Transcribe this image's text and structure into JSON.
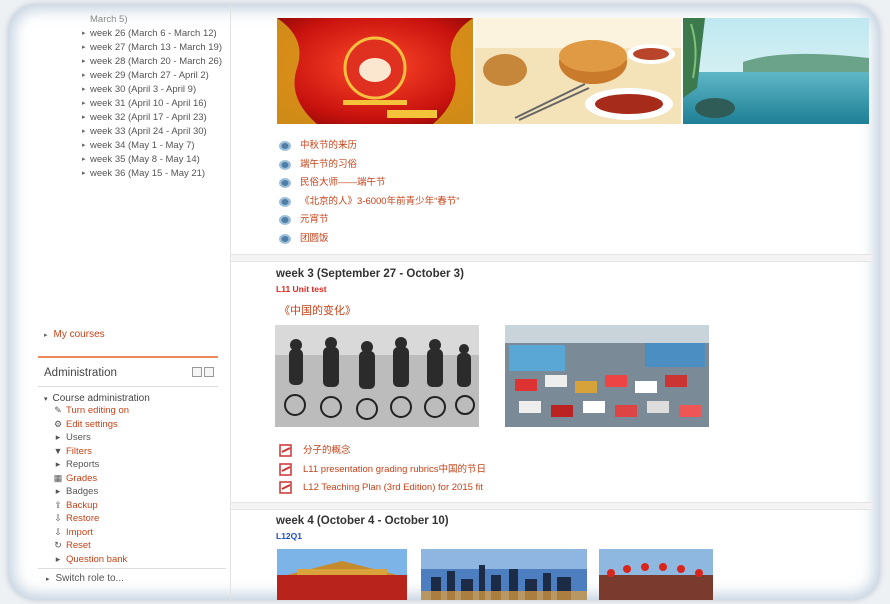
{
  "sidebar": {
    "weeks": [
      "March 5)",
      "week 26 (March 6 - March 12)",
      "week 27 (March 13 - March 19)",
      "week 28 (March 20 - March 26)",
      "week 29 (March 27 - April 2)",
      "week 30 (April 3 - April 9)",
      "week 31 (April 10 - April 16)",
      "week 32 (April 17 - April 23)",
      "week 33 (April 24 - April 30)",
      "week 34 (May 1 - May 7)",
      "week 35 (May 8 - May 14)",
      "week 36 (May 15 - May 21)"
    ],
    "my_courses": "My courses",
    "administration": {
      "title": "Administration",
      "course_admin": "Course administration",
      "items": [
        {
          "label": "Turn editing on",
          "icon": "pencil-icon",
          "glyph": "✎"
        },
        {
          "label": "Edit settings",
          "icon": "gear-icon",
          "glyph": "⚙"
        },
        {
          "label": "Users",
          "icon": "arrow-right-icon",
          "glyph": "▸"
        },
        {
          "label": "Filters",
          "icon": "filter-icon",
          "glyph": "▼"
        },
        {
          "label": "Reports",
          "icon": "arrow-right-icon",
          "glyph": "▸"
        },
        {
          "label": "Grades",
          "icon": "grades-icon",
          "glyph": "▦"
        },
        {
          "label": "Badges",
          "icon": "arrow-right-icon",
          "glyph": "▸"
        },
        {
          "label": "Backup",
          "icon": "backup-icon",
          "glyph": "⇪"
        },
        {
          "label": "Restore",
          "icon": "restore-icon",
          "glyph": "⇩"
        },
        {
          "label": "Import",
          "icon": "import-icon",
          "glyph": "⇩"
        },
        {
          "label": "Reset",
          "icon": "reset-icon",
          "glyph": "↻"
        },
        {
          "label": "Question bank",
          "icon": "arrow-right-icon",
          "glyph": "▸"
        }
      ]
    },
    "switch_role": "Switch role to..."
  },
  "main": {
    "week2_resources": [
      "中秋节的来历",
      "端午节的习俗",
      "民俗大师——端午节",
      "《北京的人》3-6000年前青少年“春节”",
      "元宵节",
      "团圆饭"
    ],
    "week3": {
      "title": "week 3 (September 27 - October 3)",
      "sublabel": "L11 Unit test",
      "heading": "《中国的变化》",
      "docs": [
        "分子的概念",
        "L11 presentation grading rubrics中国的节日",
        "L12 Teaching Plan (3rd Edition) for 2015 fit"
      ]
    },
    "week4": {
      "title": "week 4 (October 4 - October 10)",
      "sublabel": "L12Q1"
    }
  },
  "colors": {
    "accent": "#c5431a",
    "red_label": "#e0261e",
    "blue_label": "#1f4fbf"
  }
}
